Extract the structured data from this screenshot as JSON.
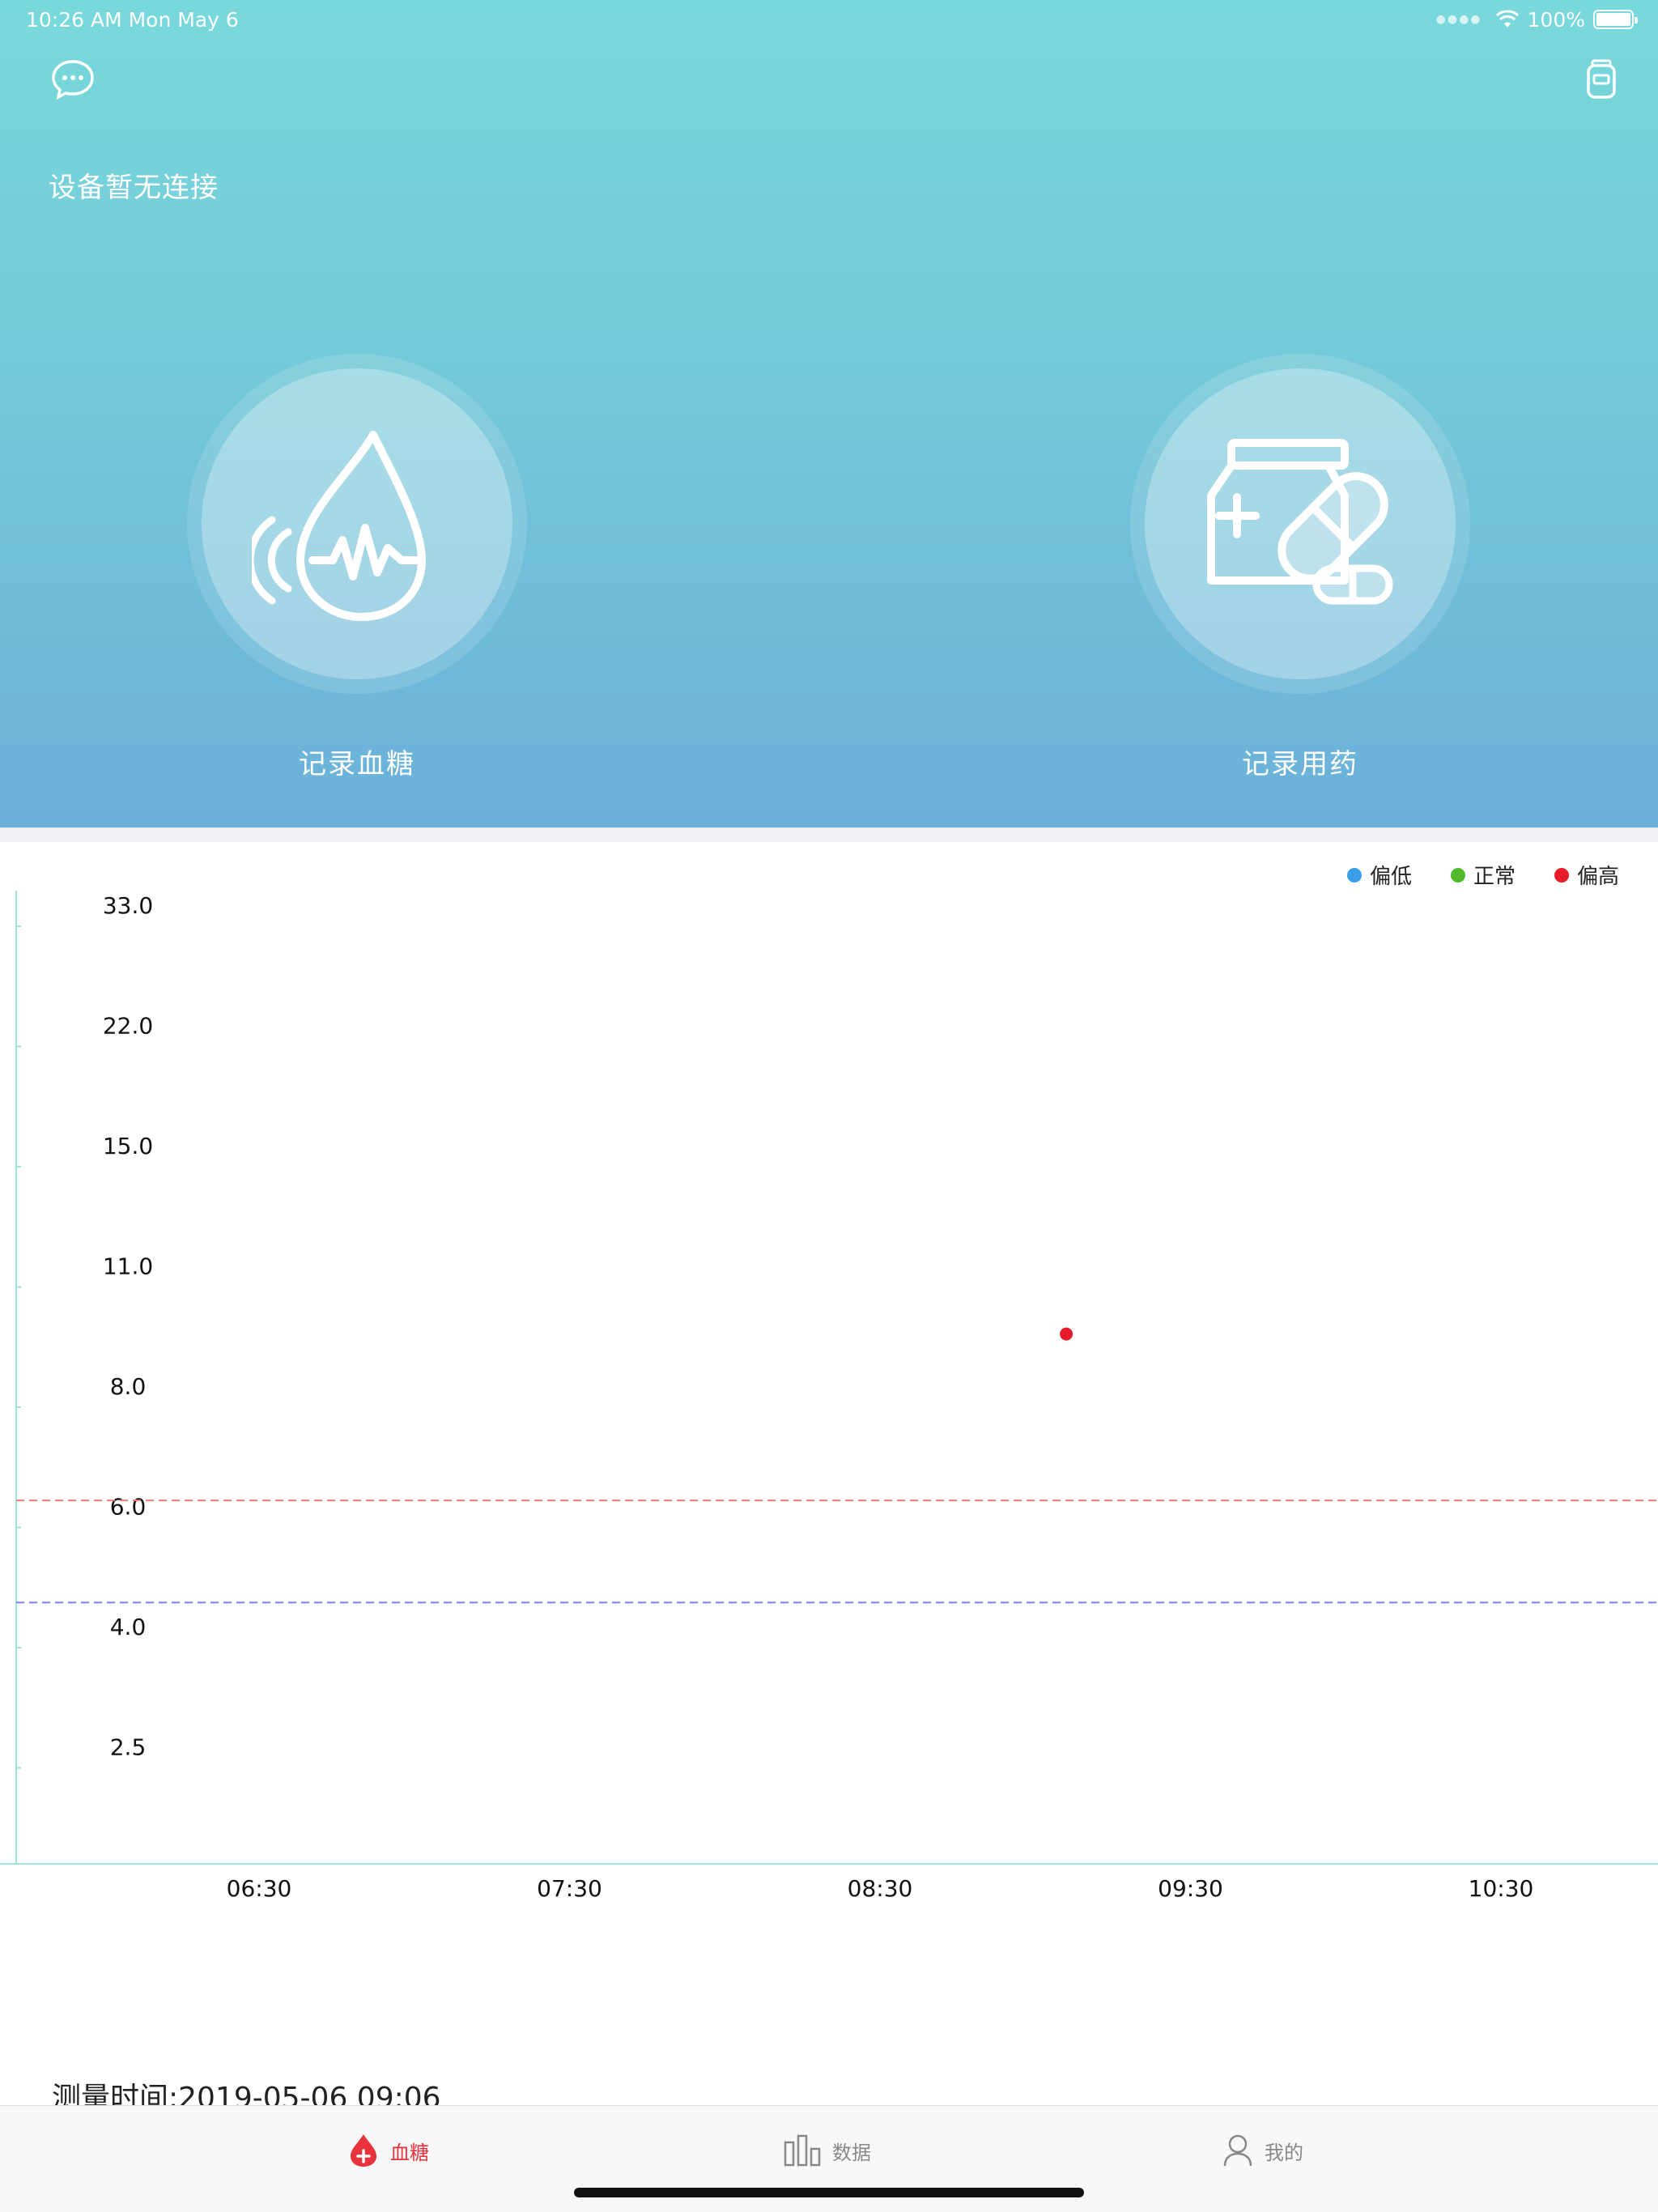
{
  "status_bar": {
    "time": "10:26 AM   Mon May 6",
    "battery": "100%"
  },
  "header": {
    "connection_status": "设备暂无连接",
    "actions": [
      {
        "label": "记录血糖",
        "icon": "blood-drop-wave-icon"
      },
      {
        "label": "记录用药",
        "icon": "medicine-bottle-pill-icon"
      }
    ]
  },
  "chart_data": {
    "type": "scatter",
    "legend": [
      {
        "label": "偏低",
        "color": "#3a9ee8"
      },
      {
        "label": "正常",
        "color": "#52b82e"
      },
      {
        "label": "偏高",
        "color": "#e81b2b"
      }
    ],
    "y_ticks": [
      "2.5",
      "4.0",
      "6.0",
      "8.0",
      "11.0",
      "15.0",
      "22.0",
      "33.0"
    ],
    "x_ticks": [
      "06:30",
      "07:30",
      "08:30",
      "09:30",
      "10:30"
    ],
    "x_tick_minutes": [
      390,
      450,
      510,
      570,
      630
    ],
    "points": [
      {
        "time": "09:06",
        "value": 9.3,
        "status": "偏高"
      }
    ],
    "thresholds": [
      {
        "value": 6.1,
        "color": "#f08080"
      },
      {
        "value": 4.4,
        "color": "#8080f0"
      }
    ]
  },
  "measure_time": "测量时间:2019-05-06 09:06",
  "tabbar": {
    "items": [
      {
        "label": "血糖",
        "active": true
      },
      {
        "label": "数据",
        "active": false
      },
      {
        "label": "我的",
        "active": false
      }
    ]
  }
}
